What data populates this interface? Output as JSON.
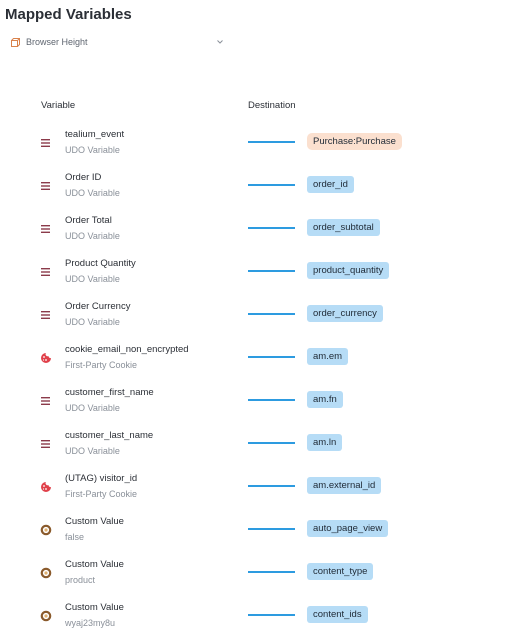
{
  "header": {
    "title": "Mapped Variables"
  },
  "selector": {
    "label": "Browser Height",
    "icon": "cube-icon"
  },
  "columns": {
    "variable": "Variable",
    "destination": "Destination"
  },
  "colors": {
    "connector": "#2d9be0",
    "destination_chip": "#b6dcf6",
    "destination_chip_alt": "#fbe0cf",
    "udo_icon": "#8b3a4a",
    "cookie_icon": "#e0404a",
    "custom_icon": "#8a5a2b"
  },
  "mappings": [
    {
      "name": "tealium_event",
      "type": "UDO Variable",
      "icon": "udo-variable-icon",
      "destination": "Purchase:Purchase",
      "chip_style": "alt"
    },
    {
      "name": "Order ID",
      "type": "UDO Variable",
      "icon": "udo-variable-icon",
      "destination": "order_id"
    },
    {
      "name": "Order Total",
      "type": "UDO Variable",
      "icon": "udo-variable-icon",
      "destination": "order_subtotal"
    },
    {
      "name": "Product Quantity",
      "type": "UDO Variable",
      "icon": "udo-variable-icon",
      "destination": "product_quantity"
    },
    {
      "name": "Order Currency",
      "type": "UDO Variable",
      "icon": "udo-variable-icon",
      "destination": "order_currency"
    },
    {
      "name": "cookie_email_non_encrypted",
      "type": "First-Party Cookie",
      "icon": "cookie-icon",
      "destination": "am.em"
    },
    {
      "name": "customer_first_name",
      "type": "UDO Variable",
      "icon": "udo-variable-icon",
      "destination": "am.fn"
    },
    {
      "name": "customer_last_name",
      "type": "UDO Variable",
      "icon": "udo-variable-icon",
      "destination": "am.ln"
    },
    {
      "name": "(UTAG) visitor_id",
      "type": "First-Party Cookie",
      "icon": "cookie-icon",
      "destination": "am.external_id"
    },
    {
      "name": "Custom Value",
      "type": "false",
      "icon": "custom-value-icon",
      "destination": "auto_page_view"
    },
    {
      "name": "Custom Value",
      "type": "product",
      "icon": "custom-value-icon",
      "destination": "content_type"
    },
    {
      "name": "Custom Value",
      "type": "wyaj23my8u",
      "icon": "custom-value-icon",
      "destination": "content_ids"
    }
  ]
}
